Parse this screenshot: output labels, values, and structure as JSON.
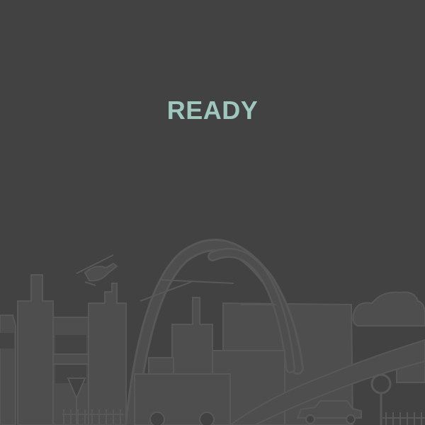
{
  "game": {
    "status_text": "READY"
  },
  "colors": {
    "background": "#424242",
    "status_text": "#9fc7bd",
    "silhouette_fill": "#4e4e4e",
    "silhouette_stroke": "#585858",
    "dark_detail": "#444444"
  },
  "scene": {
    "icons": [
      "city-skyline-icon",
      "helicopter-icon",
      "arch-bridge-icon",
      "car-icon",
      "cloud-icon",
      "road-sign-icon",
      "yield-sign-icon",
      "fence-icon"
    ]
  }
}
